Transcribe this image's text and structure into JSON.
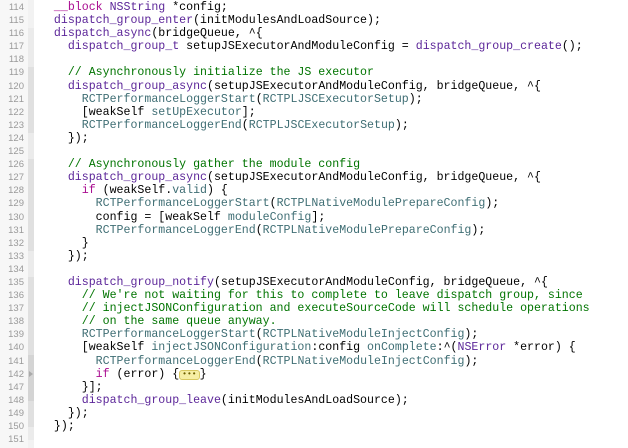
{
  "editor": {
    "lines": [
      {
        "n": "114",
        "tokens": [
          [
            "t",
            "  "
          ],
          [
            "k",
            "__block"
          ],
          [
            "t",
            " "
          ],
          [
            "f",
            "NSString"
          ],
          [
            "t",
            " *config;"
          ]
        ]
      },
      {
        "n": "115",
        "tokens": [
          [
            "t",
            "  "
          ],
          [
            "f",
            "dispatch_group_enter"
          ],
          [
            "t",
            "(initModulesAndLoadSource);"
          ]
        ]
      },
      {
        "n": "116",
        "tokens": [
          [
            "t",
            "  "
          ],
          [
            "f",
            "dispatch_async"
          ],
          [
            "t",
            "(bridgeQueue, ^{"
          ]
        ]
      },
      {
        "n": "117",
        "tokens": [
          [
            "t",
            "    "
          ],
          [
            "f",
            "dispatch_group_t"
          ],
          [
            "t",
            " setupJSExecutorAndModuleConfig = "
          ],
          [
            "f",
            "dispatch_group_create"
          ],
          [
            "t",
            "();"
          ]
        ]
      },
      {
        "n": "118",
        "tokens": []
      },
      {
        "n": "119",
        "tokens": [
          [
            "t",
            "    "
          ],
          [
            "c",
            "// Asynchronously initialize the JS executor"
          ]
        ]
      },
      {
        "n": "120",
        "tokens": [
          [
            "t",
            "    "
          ],
          [
            "f",
            "dispatch_group_async"
          ],
          [
            "t",
            "(setupJSExecutorAndModuleConfig, bridgeQueue, ^{"
          ]
        ]
      },
      {
        "n": "121",
        "tokens": [
          [
            "t",
            "      "
          ],
          [
            "p",
            "RCTPerformanceLoggerStart"
          ],
          [
            "t",
            "("
          ],
          [
            "p",
            "RCTPLJSCExecutorSetup"
          ],
          [
            "t",
            ");"
          ]
        ]
      },
      {
        "n": "122",
        "tokens": [
          [
            "t",
            "      [weakSelf "
          ],
          [
            "p",
            "setUpExecutor"
          ],
          [
            "t",
            "];"
          ]
        ]
      },
      {
        "n": "123",
        "tokens": [
          [
            "t",
            "      "
          ],
          [
            "p",
            "RCTPerformanceLoggerEnd"
          ],
          [
            "t",
            "("
          ],
          [
            "p",
            "RCTPLJSCExecutorSetup"
          ],
          [
            "t",
            ");"
          ]
        ]
      },
      {
        "n": "124",
        "tokens": [
          [
            "t",
            "    });"
          ]
        ]
      },
      {
        "n": "125",
        "tokens": []
      },
      {
        "n": "126",
        "tokens": [
          [
            "t",
            "    "
          ],
          [
            "c",
            "// Asynchronously gather the module config"
          ]
        ]
      },
      {
        "n": "127",
        "tokens": [
          [
            "t",
            "    "
          ],
          [
            "f",
            "dispatch_group_async"
          ],
          [
            "t",
            "(setupJSExecutorAndModuleConfig, bridgeQueue, ^{"
          ]
        ]
      },
      {
        "n": "128",
        "tokens": [
          [
            "t",
            "      "
          ],
          [
            "k",
            "if"
          ],
          [
            "t",
            " (weakSelf."
          ],
          [
            "p",
            "valid"
          ],
          [
            "t",
            ") {"
          ]
        ]
      },
      {
        "n": "129",
        "tokens": [
          [
            "t",
            "        "
          ],
          [
            "p",
            "RCTPerformanceLoggerStart"
          ],
          [
            "t",
            "("
          ],
          [
            "p",
            "RCTPLNativeModulePrepareConfig"
          ],
          [
            "t",
            ");"
          ]
        ]
      },
      {
        "n": "130",
        "tokens": [
          [
            "t",
            "        config = [weakSelf "
          ],
          [
            "p",
            "moduleConfig"
          ],
          [
            "t",
            "];"
          ]
        ]
      },
      {
        "n": "131",
        "tokens": [
          [
            "t",
            "        "
          ],
          [
            "p",
            "RCTPerformanceLoggerEnd"
          ],
          [
            "t",
            "("
          ],
          [
            "p",
            "RCTPLNativeModulePrepareConfig"
          ],
          [
            "t",
            ");"
          ]
        ]
      },
      {
        "n": "132",
        "tokens": [
          [
            "t",
            "      }"
          ]
        ]
      },
      {
        "n": "133",
        "tokens": [
          [
            "t",
            "    });"
          ]
        ]
      },
      {
        "n": "134",
        "tokens": []
      },
      {
        "n": "135",
        "tokens": [
          [
            "t",
            "    "
          ],
          [
            "f",
            "dispatch_group_notify"
          ],
          [
            "t",
            "(setupJSExecutorAndModuleConfig, bridgeQueue, ^{"
          ]
        ]
      },
      {
        "n": "136",
        "tokens": [
          [
            "t",
            "      "
          ],
          [
            "c",
            "// We're not waiting for this to complete to leave dispatch group, since"
          ]
        ]
      },
      {
        "n": "137",
        "tokens": [
          [
            "t",
            "      "
          ],
          [
            "c",
            "// injectJSONConfiguration and executeSourceCode will schedule operations"
          ]
        ]
      },
      {
        "n": "138",
        "tokens": [
          [
            "t",
            "      "
          ],
          [
            "c",
            "// on the same queue anyway."
          ]
        ]
      },
      {
        "n": "139",
        "tokens": [
          [
            "t",
            "      "
          ],
          [
            "p",
            "RCTPerformanceLoggerStart"
          ],
          [
            "t",
            "("
          ],
          [
            "p",
            "RCTPLNativeModuleInjectConfig"
          ],
          [
            "t",
            ");"
          ]
        ]
      },
      {
        "n": "140",
        "tokens": [
          [
            "t",
            "      [weakSelf "
          ],
          [
            "p",
            "injectJSONConfiguration"
          ],
          [
            "t",
            ":config "
          ],
          [
            "p",
            "onComplete"
          ],
          [
            "t",
            ":^("
          ],
          [
            "f",
            "NSError"
          ],
          [
            "t",
            " *error) {"
          ]
        ]
      },
      {
        "n": "141",
        "tokens": [
          [
            "t",
            "        "
          ],
          [
            "p",
            "RCTPerformanceLoggerEnd"
          ],
          [
            "t",
            "("
          ],
          [
            "p",
            "RCTPLNativeModuleInjectConfig"
          ],
          [
            "t",
            ");"
          ]
        ]
      },
      {
        "n": "142",
        "folded": true,
        "tokens": [
          [
            "t",
            "        "
          ],
          [
            "k",
            "if"
          ],
          [
            "t",
            " (error) {"
          ],
          [
            "fold",
            "•••"
          ],
          [
            "t",
            "}"
          ]
        ]
      },
      {
        "n": "147",
        "tokens": [
          [
            "t",
            "      }];"
          ]
        ]
      },
      {
        "n": "148",
        "tokens": [
          [
            "t",
            "      "
          ],
          [
            "f",
            "dispatch_group_leave"
          ],
          [
            "t",
            "(initModulesAndLoadSource);"
          ]
        ]
      },
      {
        "n": "149",
        "tokens": [
          [
            "t",
            "    });"
          ]
        ]
      },
      {
        "n": "150",
        "tokens": [
          [
            "t",
            "  });"
          ]
        ]
      },
      {
        "n": "151",
        "tokens": []
      }
    ]
  },
  "colors": {
    "keyword": "#aa0d91",
    "system": "#5c2699",
    "project": "#3f6e74",
    "comment": "#007400"
  }
}
